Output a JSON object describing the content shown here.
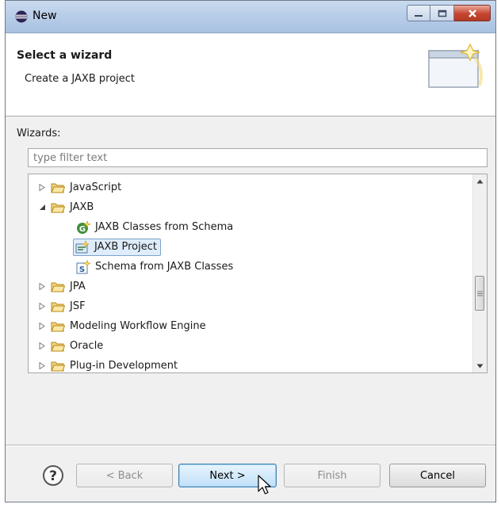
{
  "window": {
    "title": "New"
  },
  "header": {
    "title": "Select a wizard",
    "description": "Create a JAXB project"
  },
  "wizards": {
    "label": "Wizards:",
    "filter_placeholder": "type filter text",
    "tree": [
      {
        "label": "JavaScript",
        "level": 0,
        "expanded": false
      },
      {
        "label": "JAXB",
        "level": 0,
        "expanded": true
      },
      {
        "label": "JAXB Classes from Schema",
        "level": 1,
        "icon": "generate-classes-icon"
      },
      {
        "label": "JAXB Project",
        "level": 1,
        "icon": "jaxb-project-icon",
        "selected": true
      },
      {
        "label": "Schema from JAXB Classes",
        "level": 1,
        "icon": "schema-icon"
      },
      {
        "label": "JPA",
        "level": 0,
        "expanded": false
      },
      {
        "label": "JSF",
        "level": 0,
        "expanded": false
      },
      {
        "label": "Modeling Workflow Engine",
        "level": 0,
        "expanded": false
      },
      {
        "label": "Oracle",
        "level": 0,
        "expanded": false
      },
      {
        "label": "Plug-in Development",
        "level": 0,
        "expanded": false
      }
    ]
  },
  "buttons": {
    "back": "< Back",
    "next": "Next >",
    "finish": "Finish",
    "cancel": "Cancel"
  },
  "colors": {
    "selection": "#dfecfb",
    "selection_border": "#7da2ce",
    "folder": "#e8c35a"
  }
}
